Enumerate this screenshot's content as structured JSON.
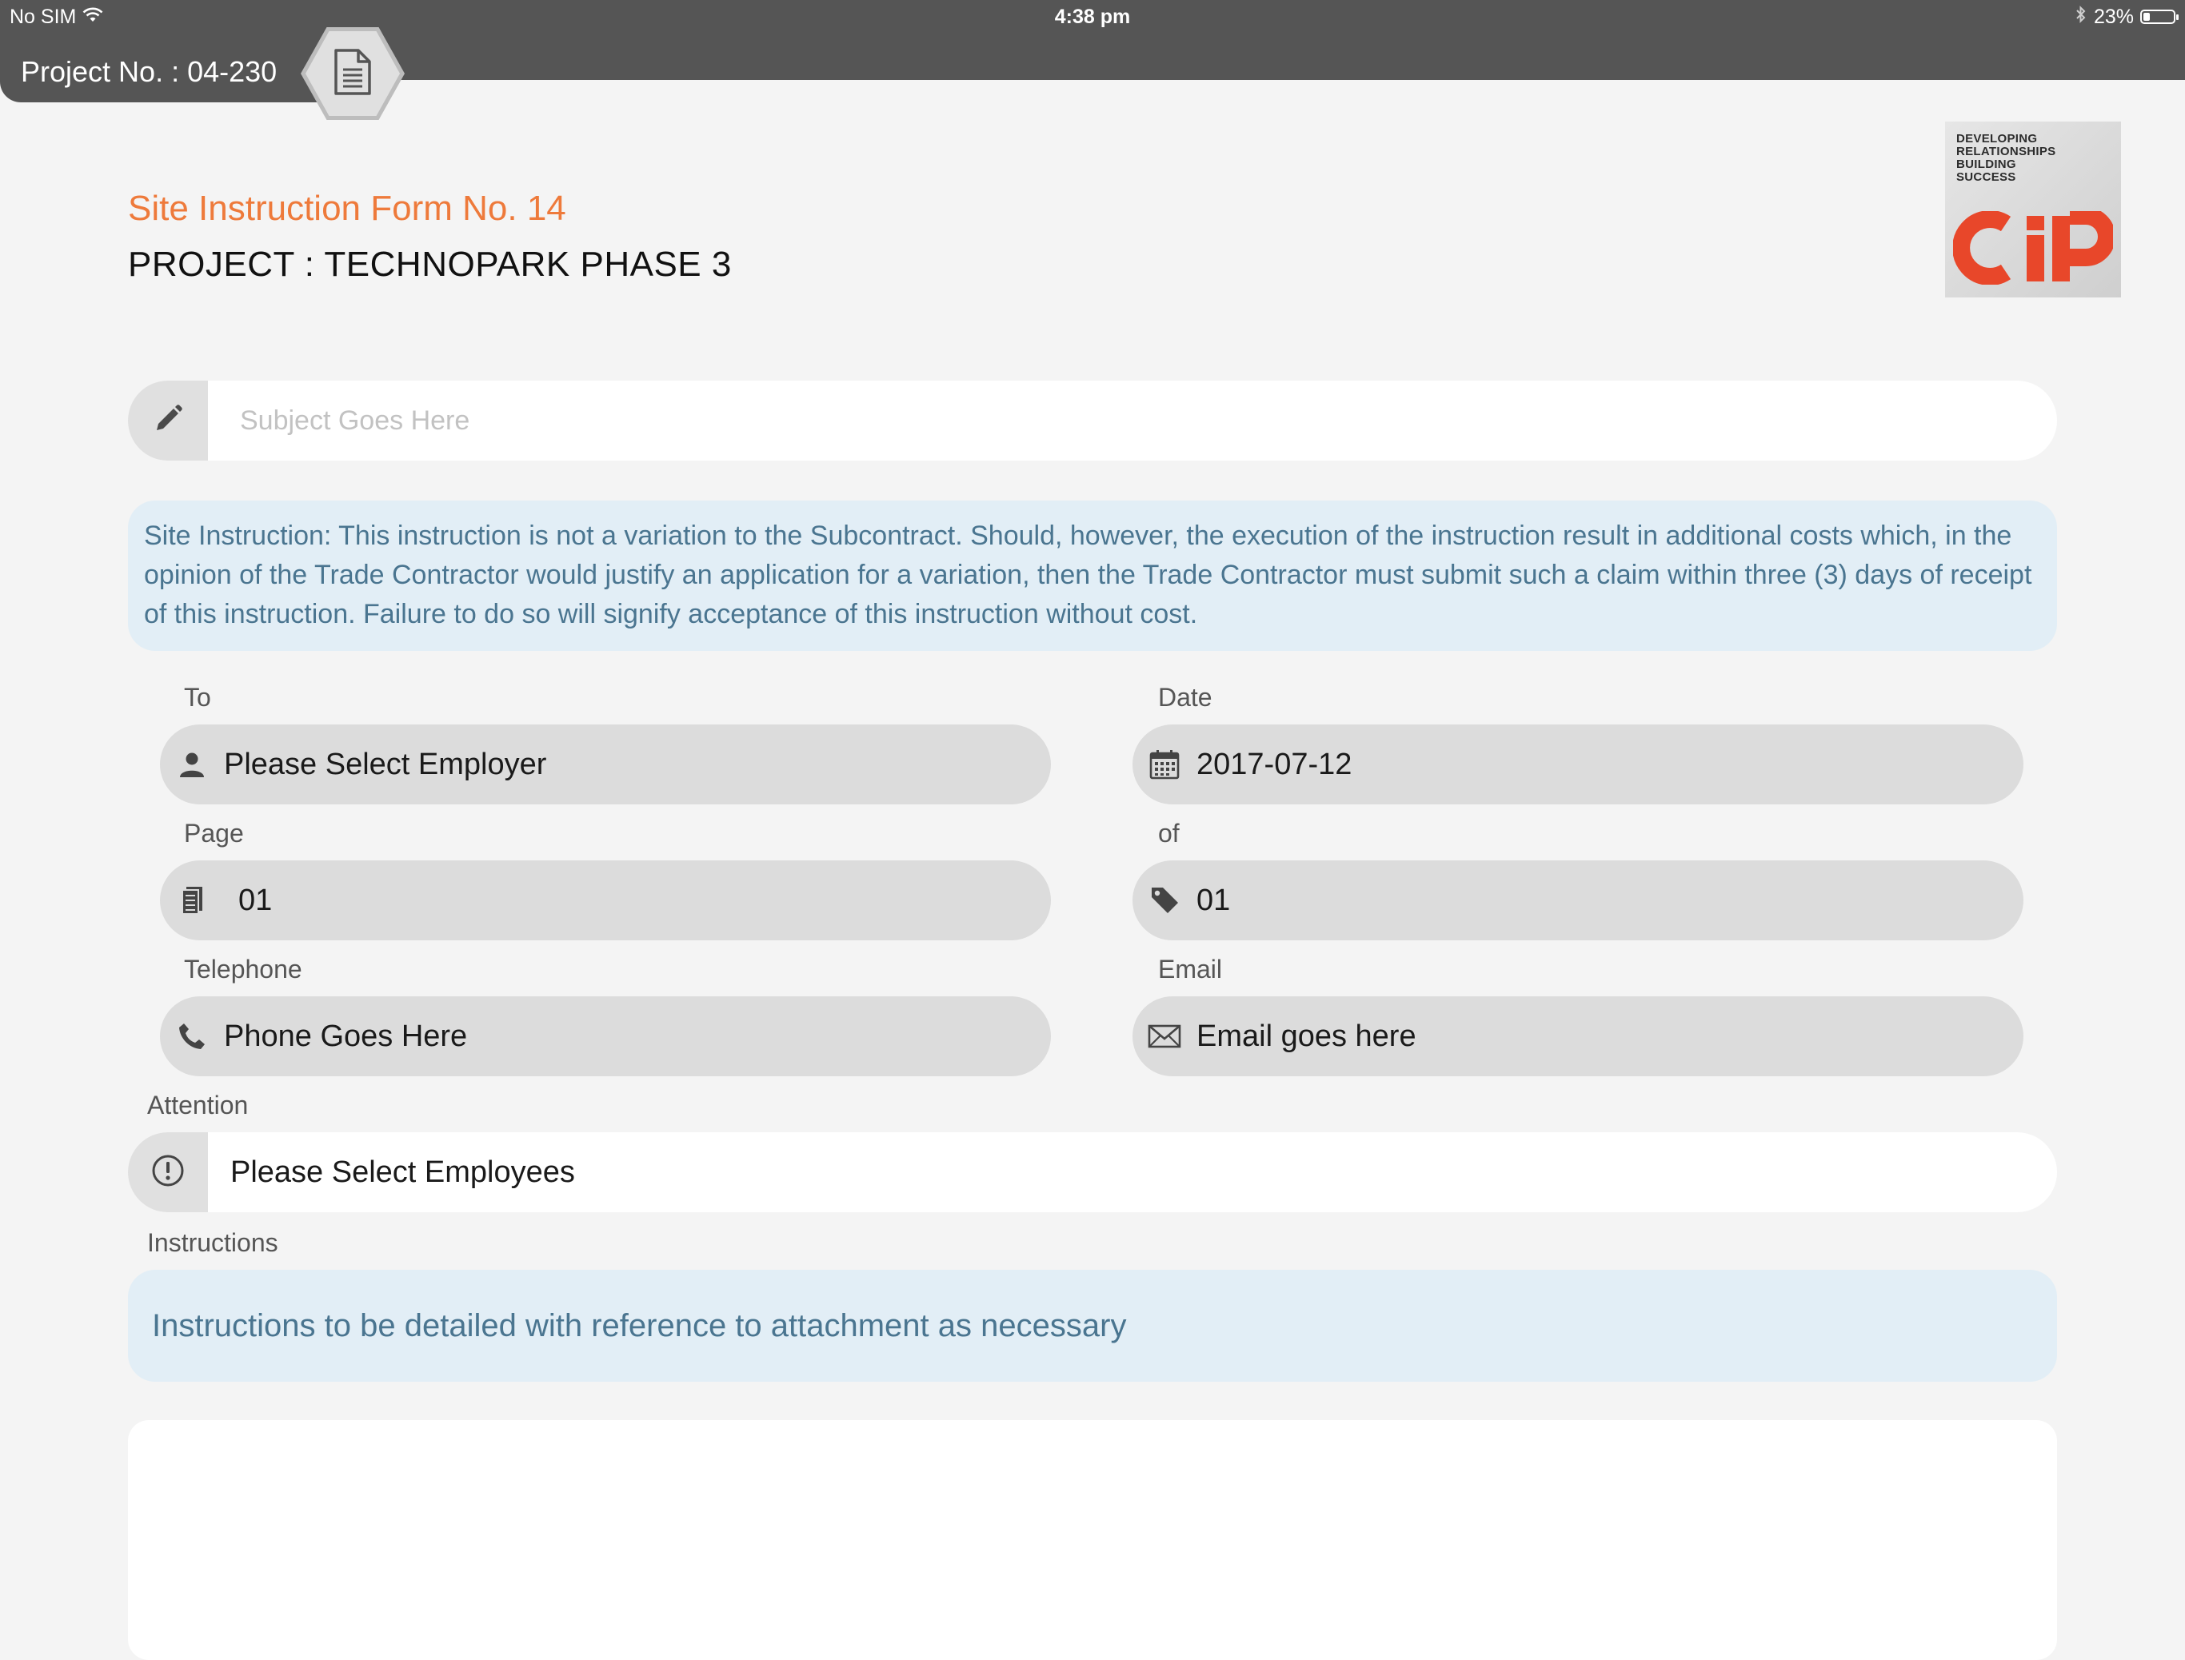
{
  "status_bar": {
    "carrier": "No SIM",
    "time": "4:38 pm",
    "battery": "23%",
    "battery_level": 0.23
  },
  "header": {
    "project_no": "Project No. : 04-230",
    "form_title": "Site Instruction Form No. 14",
    "project_title": "PROJECT : TECHNOPARK PHASE 3"
  },
  "logo": {
    "tagline_lines": [
      "DEVELOPING",
      "RELATIONSHIPS",
      "BUILDING",
      "SUCCESS"
    ],
    "brand": "CIP",
    "brand_color": "#e8472a"
  },
  "subject": {
    "placeholder": "Subject Goes Here"
  },
  "notice": {
    "text": "Site Instruction: This instruction is not a variation to the Subcontract. Should, however, the execution of the instruction result in additional costs which, in the opinion of the Trade Contractor would justify an application for a variation, then the Trade Contractor must submit such a claim within three (3) days of receipt of this instruction. Failure to do so will signify acceptance of this instruction without cost."
  },
  "fields": {
    "to": {
      "label": "To",
      "value": "Please Select Employer",
      "icon": "person-icon"
    },
    "date": {
      "label": "Date",
      "value": "2017-07-12",
      "icon": "calendar-icon"
    },
    "page": {
      "label": "Page",
      "value": "01",
      "icon": "pages-icon"
    },
    "of": {
      "label": "of",
      "value": "01",
      "icon": "tag-icon"
    },
    "telephone": {
      "label": "Telephone",
      "value": "Phone Goes Here",
      "icon": "phone-icon"
    },
    "email": {
      "label": "Email",
      "value": "Email goes here",
      "icon": "envelope-icon"
    }
  },
  "attention": {
    "label": "Attention",
    "value": "Please Select Employees",
    "icon": "alert-circle-icon"
  },
  "instructions": {
    "label": "Instructions",
    "text": "Instructions to be detailed with reference to attachment as necessary"
  },
  "colors": {
    "accent": "#ee7a3b",
    "topbar": "#555555",
    "info_bg": "#e2eef6",
    "info_text": "#4a7590"
  }
}
